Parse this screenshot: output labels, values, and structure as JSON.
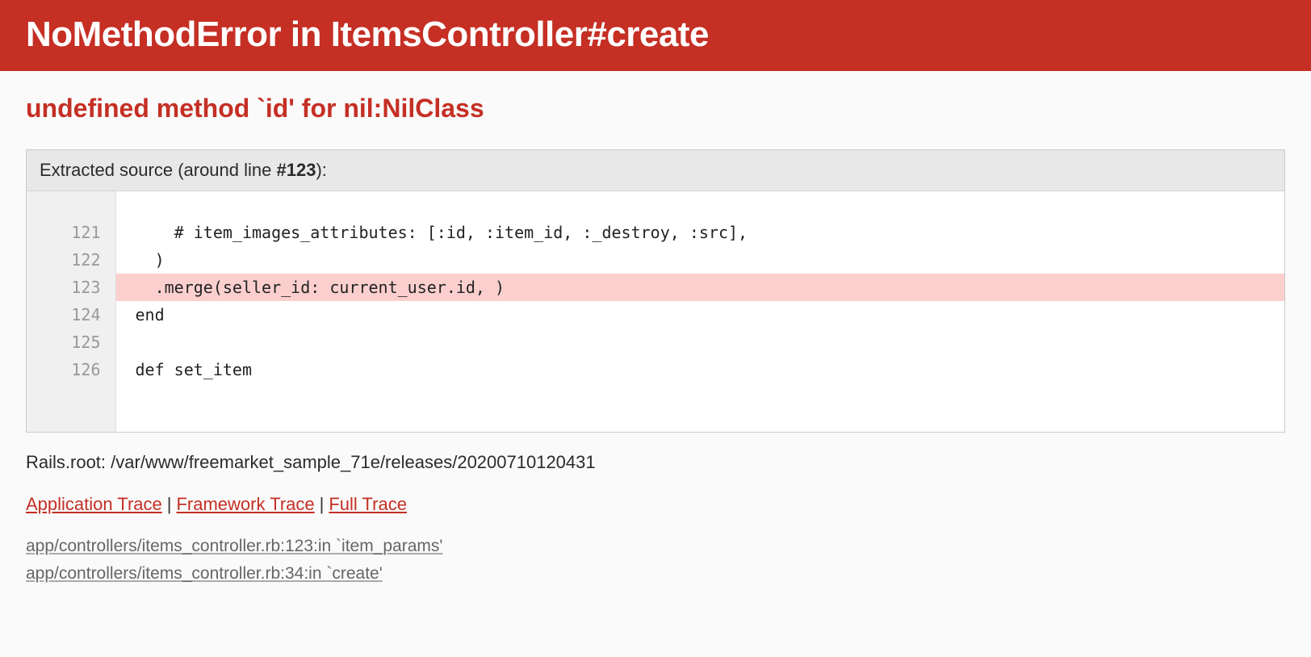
{
  "header": {
    "title": "NoMethodError in ItemsController#create"
  },
  "error": {
    "message": "undefined method `id' for nil:NilClass"
  },
  "source": {
    "label_prefix": "Extracted source (around line ",
    "highlight_line": "#123",
    "label_suffix": "):",
    "lines": {
      "l121": "121",
      "c121": "    # item_images_attributes: [:id, :item_id, :_destroy, :src],",
      "l122": "122",
      "c122": "  )",
      "l123": "123",
      "c123": "  .merge(seller_id: current_user.id, )",
      "l124": "124",
      "c124": "end",
      "l125": "125",
      "c125": "",
      "l126": "126",
      "c126": "def set_item"
    }
  },
  "rails_root": {
    "text": "Rails.root: /var/www/freemarket_sample_71e/releases/20200710120431"
  },
  "traces": {
    "application": "Application Trace",
    "framework": "Framework Trace",
    "full": "Full Trace"
  },
  "trace_lines": {
    "t1": "app/controllers/items_controller.rb:123:in `item_params'",
    "t2": "app/controllers/items_controller.rb:34:in `create'"
  }
}
